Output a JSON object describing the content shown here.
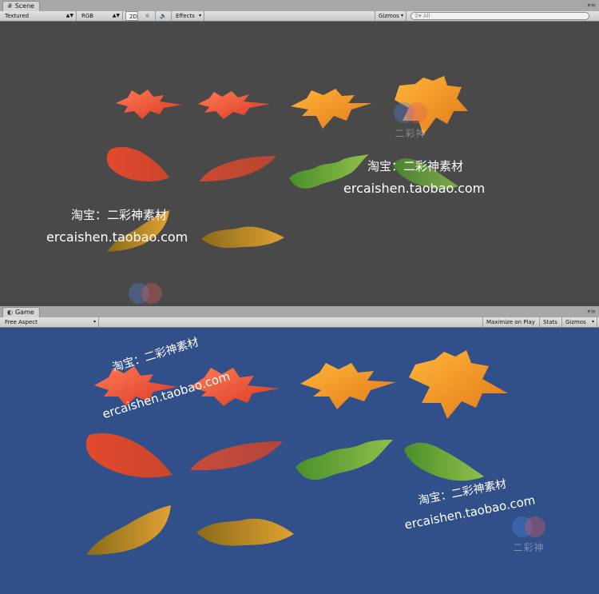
{
  "scene": {
    "tab_label": "Scene",
    "render_mode": "Textured",
    "color_mode": "RGB",
    "toggle_2d": "2D",
    "effects_label": "Effects",
    "gizmos_label": "Gizmos",
    "search_placeholder": "All",
    "background": "#494949"
  },
  "game": {
    "tab_label": "Game",
    "aspect": "Free Aspect",
    "maximize_label": "Maximize on Play",
    "stats_label": "Stats",
    "gizmos_label": "Gizmos",
    "background": "#315089"
  },
  "watermarks": {
    "line1": "淘宝：二彩神素材",
    "line2": "ercaishen.taobao.com",
    "logo_text": "二彩神"
  },
  "icons": [
    "sun-icon",
    "speaker-icon",
    "scene-tab-icon",
    "game-tab-icon",
    "search-icon"
  ]
}
